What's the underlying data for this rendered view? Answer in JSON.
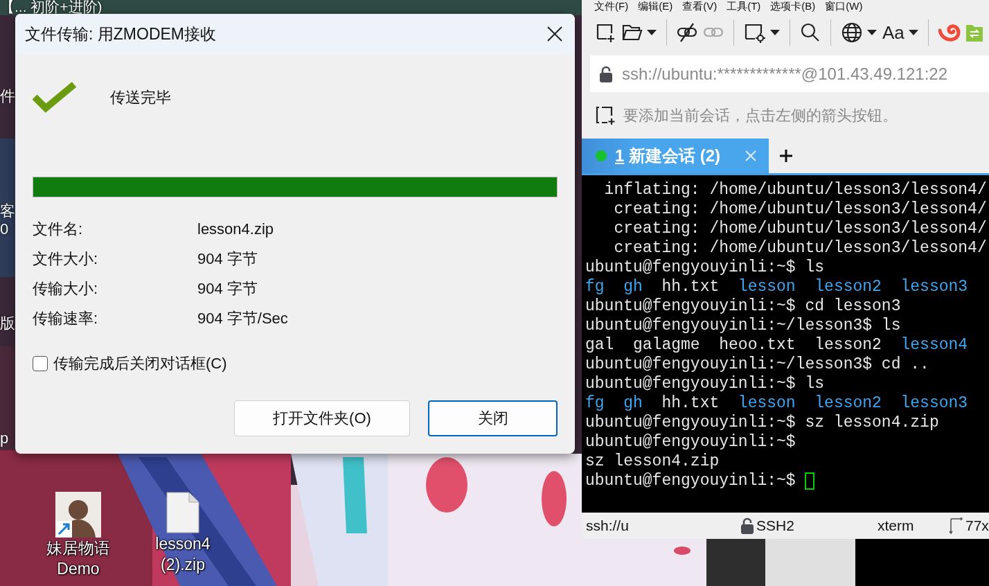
{
  "desktop": {
    "top_text": "【... 初阶+进阶)",
    "edge_labels": [
      "件",
      "客",
      "0",
      "版",
      "p"
    ],
    "icons": [
      {
        "kind": "app",
        "label_lines": [
          "妹居物语",
          "Demo"
        ]
      },
      {
        "kind": "file",
        "label_lines": [
          "lesson4",
          "(2).zip"
        ]
      }
    ]
  },
  "dialog": {
    "title": "文件传输: 用ZMODEM接收",
    "status": "传送完毕",
    "progress": {
      "level": 1
    },
    "fields": [
      {
        "label": "文件名:",
        "value": "lesson4.zip"
      },
      {
        "label": "文件大小:",
        "value": "904 字节"
      },
      {
        "label": "传输大小:",
        "value": "904 字节"
      },
      {
        "label": "传输速率:",
        "value": "904 字节/Sec"
      }
    ],
    "checkbox": {
      "label": "传输完成后关闭对话框(C)",
      "checked": false
    },
    "buttons": [
      {
        "label": "打开文件夹(O)",
        "default": false
      },
      {
        "label": "关闭",
        "default": true
      }
    ]
  },
  "terminal_window": {
    "menu": [
      "文件(F)",
      "编辑(E)",
      "查看(V)",
      "工具(T)",
      "选项卡(B)",
      "窗口(W)"
    ],
    "toolbar": [
      {
        "kind": "new-session",
        "dropdown": false,
        "disabled": false
      },
      {
        "kind": "open",
        "dropdown": true,
        "disabled": false
      },
      {
        "kind": "separator"
      },
      {
        "kind": "disconnect",
        "dropdown": false,
        "disabled": false
      },
      {
        "kind": "reconnect",
        "dropdown": false,
        "disabled": true
      },
      {
        "kind": "separator"
      },
      {
        "kind": "session-settings",
        "dropdown": true,
        "disabled": false
      },
      {
        "kind": "separator"
      },
      {
        "kind": "search",
        "dropdown": false,
        "disabled": false
      },
      {
        "kind": "separator"
      },
      {
        "kind": "globe",
        "dropdown": true,
        "disabled": false
      },
      {
        "kind": "font",
        "label": "Aa",
        "dropdown": true,
        "disabled": false
      },
      {
        "kind": "separator"
      },
      {
        "kind": "swirl",
        "dropdown": false,
        "disabled": false
      },
      {
        "kind": "transfer",
        "dropdown": false,
        "disabled": false
      }
    ],
    "address": "ssh://ubuntu:*************@101.43.49.121:22",
    "hint": "要添加当前会话，点击左侧的箭头按钮。",
    "tabs": [
      {
        "number": "1",
        "label": "新建会话 (2)",
        "selected": true,
        "connected": true
      }
    ],
    "lines": [
      [
        {
          "text": "  inflating: /home/ubuntu/lesson3/lesson4/",
          "color": "#e8e8e8"
        }
      ],
      [
        {
          "text": "   creating: /home/ubuntu/lesson3/lesson4/",
          "color": "#e8e8e8"
        }
      ],
      [
        {
          "text": "   creating: /home/ubuntu/lesson3/lesson4/",
          "color": "#e8e8e8"
        }
      ],
      [
        {
          "text": "   creating: /home/ubuntu/lesson3/lesson4/",
          "color": "#e8e8e8"
        }
      ],
      [
        {
          "text": "ubuntu@fengyouyinli:~$ ls",
          "color": "#e8e8e8"
        }
      ],
      [
        {
          "text": "fg  ",
          "color": "#3ea6f0"
        },
        {
          "text": "gh  ",
          "color": "#3ea6f0"
        },
        {
          "text": "hh.txt  ",
          "color": "#e8e8e8"
        },
        {
          "text": "lesson  ",
          "color": "#3ea6f0"
        },
        {
          "text": "lesson2  ",
          "color": "#3ea6f0"
        },
        {
          "text": "lesson3",
          "color": "#3ea6f0"
        }
      ],
      [
        {
          "text": "ubuntu@fengyouyinli:~$ cd lesson3",
          "color": "#e8e8e8"
        }
      ],
      [
        {
          "text": "ubuntu@fengyouyinli:~/lesson3$ ls",
          "color": "#e8e8e8"
        }
      ],
      [
        {
          "text": "gal  galagme  heoo.txt  lesson2  ",
          "color": "#e8e8e8"
        },
        {
          "text": "lesson4",
          "color": "#3ea6f0"
        }
      ],
      [
        {
          "text": "ubuntu@fengyouyinli:~/lesson3$ cd ..",
          "color": "#e8e8e8"
        }
      ],
      [
        {
          "text": "ubuntu@fengyouyinli:~$ ls",
          "color": "#e8e8e8"
        }
      ],
      [
        {
          "text": "fg  ",
          "color": "#3ea6f0"
        },
        {
          "text": "gh  ",
          "color": "#3ea6f0"
        },
        {
          "text": "hh.txt  ",
          "color": "#e8e8e8"
        },
        {
          "text": "lesson  ",
          "color": "#3ea6f0"
        },
        {
          "text": "lesson2  ",
          "color": "#3ea6f0"
        },
        {
          "text": "lesson3",
          "color": "#3ea6f0"
        }
      ],
      [
        {
          "text": "ubuntu@fengyouyinli:~$ sz lesson4.zip",
          "color": "#e8e8e8"
        }
      ],
      [
        {
          "text": "ubuntu@fengyouyinli:~$",
          "color": "#e8e8e8"
        }
      ],
      [
        {
          "text": "sz lesson4.zip",
          "color": "#e8e8e8"
        }
      ],
      [
        {
          "text": "ubuntu@fengyouyinli:~$ ",
          "color": "#e8e8e8"
        }
      ]
    ],
    "status_bar": {
      "address": "ssh://u",
      "protocol": "SSH2",
      "terminal_type": "xterm",
      "size": "77x"
    }
  }
}
